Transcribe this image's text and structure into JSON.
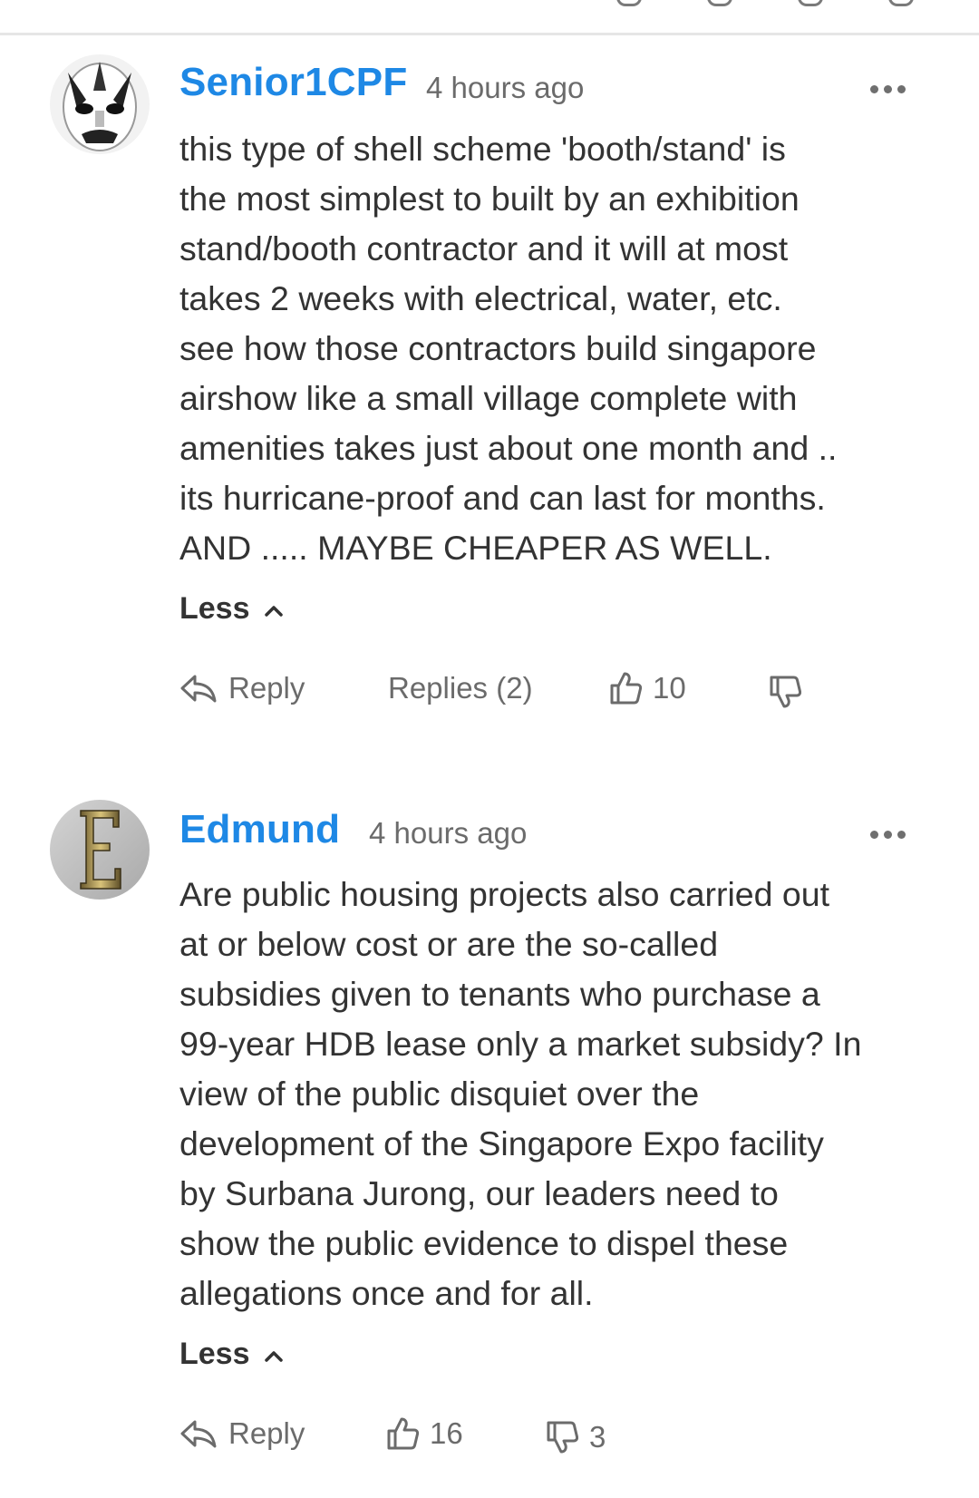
{
  "comments": [
    {
      "author": "Senior1CPF",
      "time": "4 hours ago",
      "avatar_icon": "masked-face-avatar",
      "body_lines": [
        "this type of shell scheme 'booth/stand' is",
        "the most simplest to built by an exhibition",
        "stand/booth contractor and it will at most",
        "takes 2 weeks with electrical, water, etc.",
        "see how those contractors build singapore",
        "airshow like a small village complete with",
        "amenities takes just about one month and ..",
        "its hurricane-proof and can last for months.",
        "AND ..... MAYBE CHEAPER AS WELL."
      ],
      "less_label": "Less",
      "reply_label": "Reply",
      "replies_label": "Replies (2)",
      "upvotes": "10",
      "downvotes": ""
    },
    {
      "author": "Edmund",
      "time": "4 hours ago",
      "avatar_icon": "letter-e-avatar",
      "body_lines": [
        "Are public housing projects also carried out",
        "at or below cost or are the so-called",
        "subsidies given to tenants who purchase a",
        "99-year HDB lease only a market subsidy? In",
        "view of the public disquiet over the",
        "development of the Singapore Expo facility",
        "by Surbana Jurong, our leaders need to",
        "show the public evidence to dispel these",
        "allegations once and for all."
      ],
      "less_label": "Less",
      "reply_label": "Reply",
      "upvotes": "16",
      "downvotes": "3"
    }
  ],
  "icons": {
    "more": "more-dots-icon",
    "reply": "reply-arrow-icon",
    "upvote": "thumbs-up-icon",
    "downvote": "thumbs-down-icon",
    "collapse": "chevron-up-icon"
  },
  "colors": {
    "author": "#1e88e5",
    "text": "#333333",
    "muted": "#6b6b6b",
    "divider": "#e6e6e6"
  }
}
